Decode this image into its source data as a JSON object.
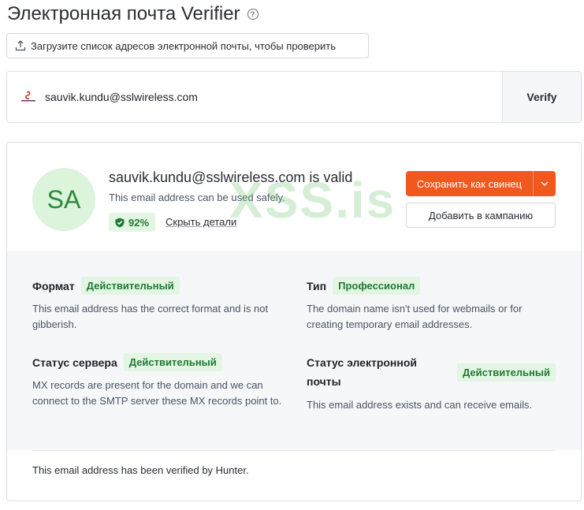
{
  "header": {
    "title": "Электронная почта Verifier",
    "help_icon": "question-circle-icon"
  },
  "upload": {
    "label": "Загрузите список адресов электронной почты, чтобы проверить",
    "icon": "upload-icon"
  },
  "verify_form": {
    "email_value": "sauvik.kundu@sslwireless.com",
    "favicon": "domain-favicon-icon",
    "button_label": "Verify"
  },
  "result": {
    "avatar_initials": "SA",
    "title": "sauvik.kundu@sslwireless.com is valid",
    "subtitle": "This email address can be used safely.",
    "score": "92%",
    "score_icon": "shield-check-icon",
    "hide_details_label": "Скрыть детали",
    "save_lead_label": "Сохранить как свинец",
    "add_campaign_label": "Добавить в кампанию",
    "watermark": "XSS.is",
    "checks": [
      {
        "label": "Формат",
        "status": "Действительный",
        "description": "This email address has the correct format and is not gibberish."
      },
      {
        "label": "Тип",
        "status": "Профессионал",
        "description": "The domain name isn't used for webmails or for creating temporary email addresses."
      },
      {
        "label": "Статус сервера",
        "status": "Действительный",
        "description": "MX records are present for the domain and we can connect to the SMTP server these MX records point to."
      },
      {
        "label": "Статус электронной почты",
        "status": "Действительный",
        "description": "This email address exists and can receive emails."
      }
    ],
    "footer_note": "This email address has been verified by Hunter."
  },
  "colors": {
    "accent_orange": "#f0581e",
    "valid_green_bg": "#e3f5e3",
    "valid_green_text": "#1f7a31",
    "avatar_bg": "#dcf3dc"
  }
}
